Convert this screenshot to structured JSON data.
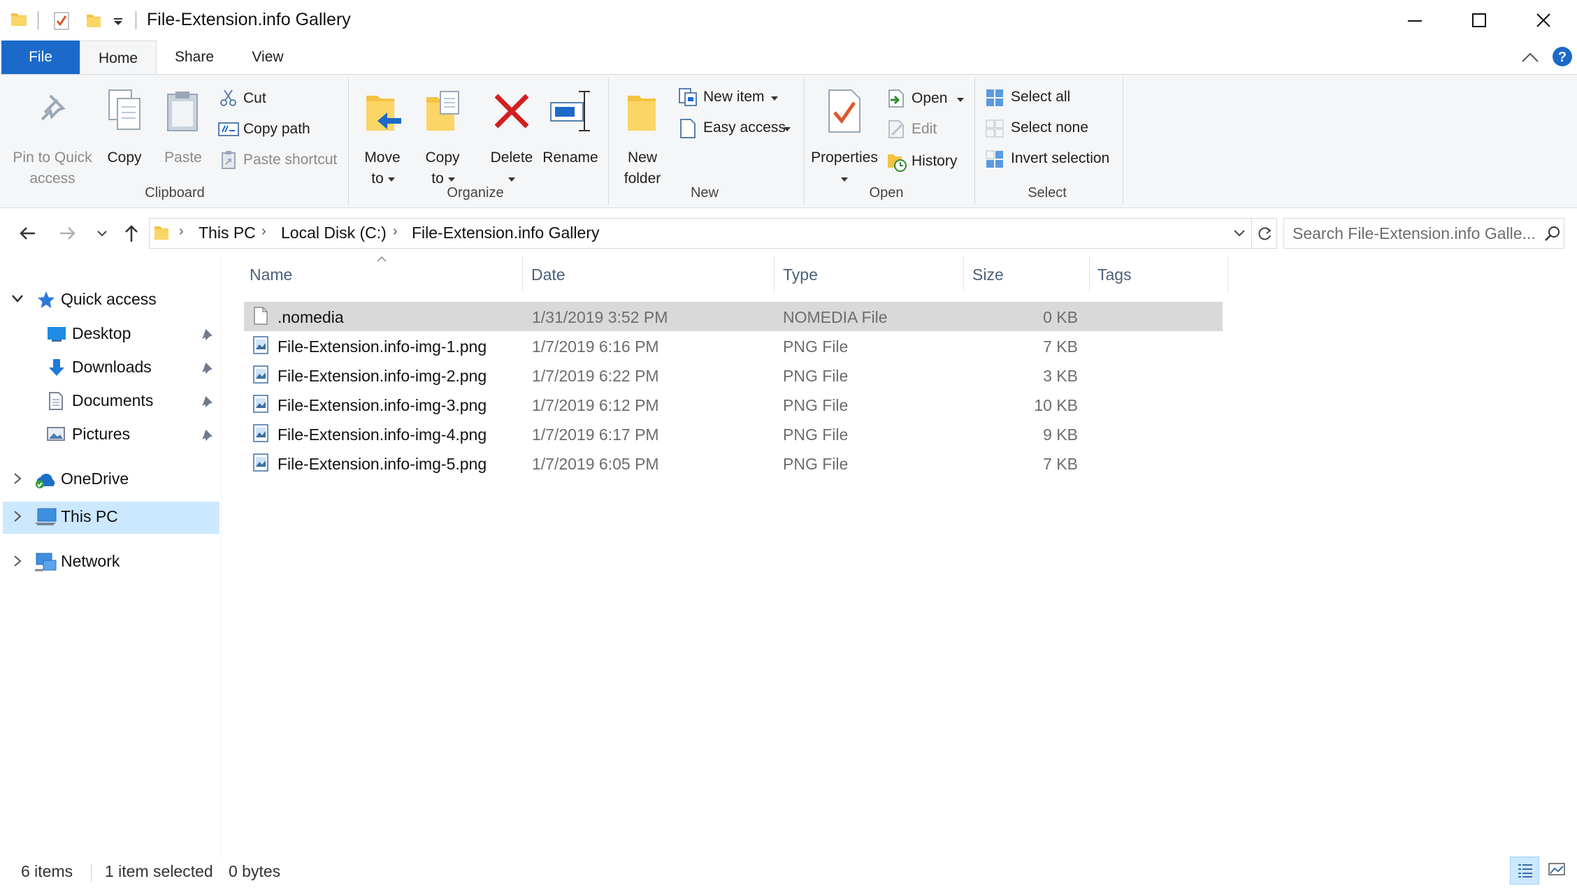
{
  "window": {
    "title": "File-Extension.info Gallery"
  },
  "tabs": [
    {
      "label": "File"
    },
    {
      "label": "Home"
    },
    {
      "label": "Share"
    },
    {
      "label": "View"
    }
  ],
  "ribbon": {
    "clipboard": {
      "group_label": "Clipboard",
      "pin_label_1": "Pin to Quick",
      "pin_label_2": "access",
      "copy": "Copy",
      "paste": "Paste",
      "cut": "Cut",
      "copy_path": "Copy path",
      "paste_shortcut": "Paste shortcut"
    },
    "organize": {
      "group_label": "Organize",
      "move_to_1": "Move",
      "move_to_2": "to",
      "copy_to_1": "Copy",
      "copy_to_2": "to",
      "delete": "Delete",
      "rename": "Rename"
    },
    "new": {
      "group_label": "New",
      "new_folder_1": "New",
      "new_folder_2": "folder",
      "new_item": "New item",
      "easy_access": "Easy access"
    },
    "open": {
      "group_label": "Open",
      "properties": "Properties",
      "open": "Open",
      "edit": "Edit",
      "history": "History"
    },
    "select": {
      "group_label": "Select",
      "select_all": "Select all",
      "select_none": "Select none",
      "invert_selection": "Invert selection"
    }
  },
  "address": {
    "crumbs": [
      "This PC",
      "Local Disk (C:)",
      "File-Extension.info Gallery"
    ],
    "search_placeholder": "Search File-Extension.info Galle..."
  },
  "nav_pane": {
    "quick_access": "Quick access",
    "pinned": [
      "Desktop",
      "Downloads",
      "Documents",
      "Pictures"
    ],
    "onedrive": "OneDrive",
    "this_pc": "This PC",
    "network": "Network"
  },
  "columns": {
    "name": "Name",
    "date": "Date",
    "type": "Type",
    "size": "Size",
    "tags": "Tags"
  },
  "files": [
    {
      "name": ".nomedia",
      "date": "1/31/2019 3:52 PM",
      "type": "NOMEDIA File",
      "size": "0 KB",
      "icon": "blank-file-icon"
    },
    {
      "name": "File-Extension.info-img-1.png",
      "date": "1/7/2019 6:16 PM",
      "type": "PNG File",
      "size": "7 KB",
      "icon": "png-image-icon"
    },
    {
      "name": "File-Extension.info-img-2.png",
      "date": "1/7/2019 6:22 PM",
      "type": "PNG File",
      "size": "3 KB",
      "icon": "png-image-icon"
    },
    {
      "name": "File-Extension.info-img-3.png",
      "date": "1/7/2019 6:12 PM",
      "type": "PNG File",
      "size": "10 KB",
      "icon": "png-image-icon"
    },
    {
      "name": "File-Extension.info-img-4.png",
      "date": "1/7/2019 6:17 PM",
      "type": "PNG File",
      "size": "9 KB",
      "icon": "png-image-icon"
    },
    {
      "name": "File-Extension.info-img-5.png",
      "date": "1/7/2019 6:05 PM",
      "type": "PNG File",
      "size": "7 KB",
      "icon": "png-image-icon"
    }
  ],
  "status": {
    "items": "6 items",
    "selected": "1 item selected",
    "bytes": "0 bytes"
  },
  "colors": {
    "accent": "#1b6ac9",
    "selection": "#d9d9d9",
    "nav_selection": "#cce8ff"
  }
}
